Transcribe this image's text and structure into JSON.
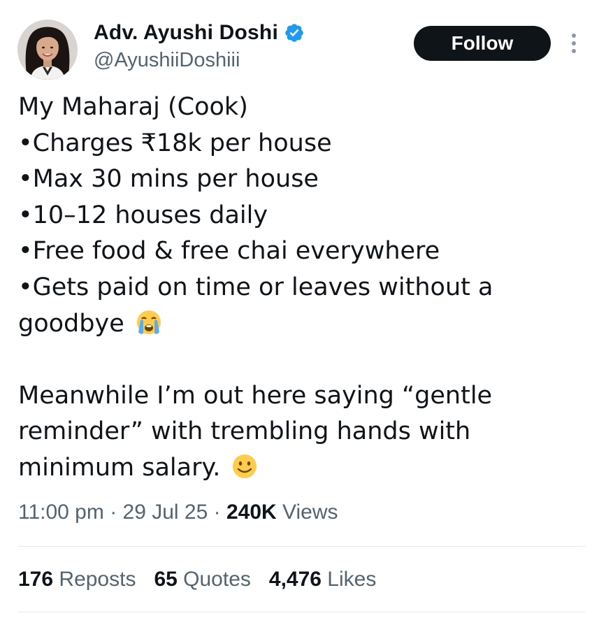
{
  "author": {
    "display_name": "Adv. Ayushi Doshi",
    "handle": "@AyushiiDoshiii",
    "verified": true,
    "avatar_icon": "profile-photo-avatar"
  },
  "actions": {
    "follow_label": "Follow",
    "more_icon": "vertical-ellipsis-icon"
  },
  "tweet": {
    "lines": [
      "My Maharaj (Cook)",
      "•Charges ₹18k per house",
      "•Max 30 mins per house",
      "•10–12 houses daily",
      "•Free food & free chai everywhere",
      "•Gets paid on time or leaves without a",
      "goodbye",
      "",
      "Meanwhile I’m out here saying “gentle",
      "reminder” with trembling hands with",
      "minimum salary."
    ],
    "emoji_crying": "loudly-crying-face-emoji",
    "emoji_smile": "slightly-smiling-face-emoji"
  },
  "meta": {
    "time": "11:00 pm",
    "sep1": " · ",
    "date": "29 Jul 25",
    "sep2": " · ",
    "views_count": "240K",
    "views_label": " Views"
  },
  "stats": {
    "reposts_count": "176",
    "reposts_label": " Reposts",
    "quotes_count": "65",
    "quotes_label": " Quotes",
    "likes_count": "4,476",
    "likes_label": " Likes"
  },
  "colors": {
    "text_primary": "#0f1419",
    "text_secondary": "#536471",
    "verified_blue": "#1d9bf0",
    "follow_bg": "#0f1419",
    "divider": "#e7e9ea"
  }
}
